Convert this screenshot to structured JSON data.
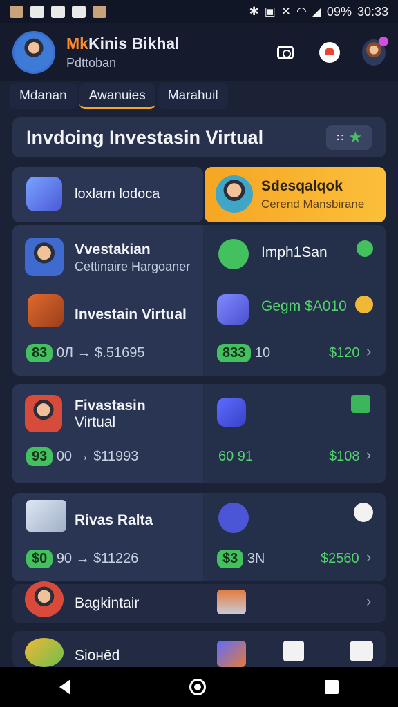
{
  "status": {
    "battery": "09%",
    "time": "30:33"
  },
  "header": {
    "name_accent": "Mk",
    "name_rest": "Kinis Bikhal",
    "role": "Pdttoban"
  },
  "tabs": [
    {
      "label": "Mdanan"
    },
    {
      "label": "Awanuies"
    },
    {
      "label": "Marahuil"
    }
  ],
  "banner": {
    "title": "Invdoing Investasin Virtual",
    "dots": "::"
  },
  "row1": {
    "left_label": "loxlarn lodoca",
    "right_title": "Sdesqalqok",
    "right_sub": "Cerend Mansbirane"
  },
  "card1": {
    "a_title": "Vvestakian",
    "a_sub": "Cettinaire Hargoaner",
    "b_title": "Imph1San",
    "c_title": "Investain Virtual",
    "d_title": "Gegm $A010",
    "e_pill": "83",
    "e_text": "0Л → $.51695",
    "f_pill": "833",
    "f_text": "10",
    "f_amount": "$120"
  },
  "card2": {
    "title": "Fivastasin",
    "sub": "Virtual",
    "pill": "93",
    "text": "00 → $11993",
    "right_text": "60 91",
    "amount": "$108"
  },
  "card3": {
    "title": "Rivas Ralta",
    "pill": "$0",
    "text": "90 → $11226",
    "right_pill": "$3",
    "right_text": "3N",
    "amount": "$2560"
  },
  "card4": {
    "title": "Bagkintair"
  },
  "card5": {
    "title": "Sioнēd"
  },
  "colors": {
    "accent": "#f6a623",
    "positive": "#43c15e",
    "bg": "#1b2236"
  }
}
